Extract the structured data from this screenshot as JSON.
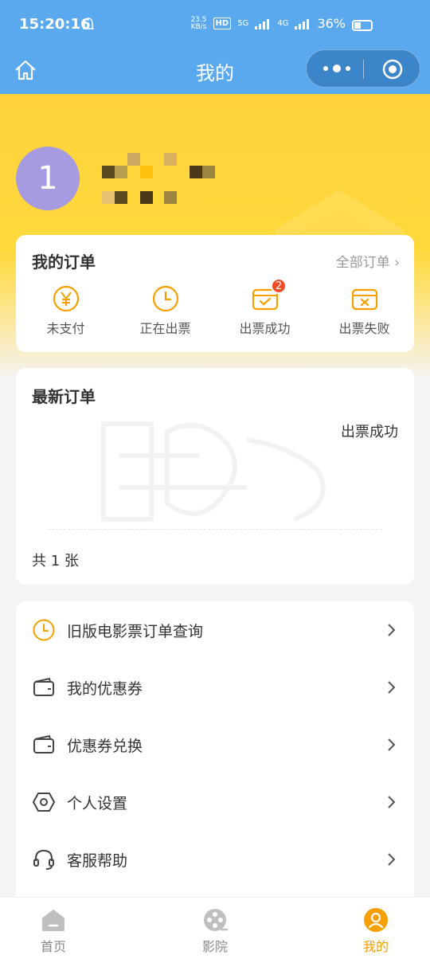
{
  "status_bar": {
    "time": "15:20:16",
    "net_speed_top": "23.5",
    "net_speed_bottom": "KB/s",
    "hd_tag": "HD",
    "sim1": "5G",
    "sim2": "4G",
    "battery": "36%"
  },
  "nav": {
    "title": "我的"
  },
  "profile": {
    "avatar_initial": "1"
  },
  "orders": {
    "title": "我的订单",
    "all_label": "全部订单 ›",
    "items": [
      {
        "label": "未支付",
        "icon": "yen-icon"
      },
      {
        "label": "正在出票",
        "icon": "clock-icon"
      },
      {
        "label": "出票成功",
        "icon": "ticket-check-icon",
        "badge": "2"
      },
      {
        "label": "出票失败",
        "icon": "ticket-cross-icon"
      }
    ]
  },
  "latest": {
    "title": "最新订单",
    "status": "出票成功",
    "count": "共 1 张"
  },
  "menu": {
    "items": [
      {
        "label": "旧版电影票订单查询",
        "icon": "clock-icon"
      },
      {
        "label": "我的优惠券",
        "icon": "wallet-icon"
      },
      {
        "label": "优惠券兑换",
        "icon": "wallet-icon"
      },
      {
        "label": "个人设置",
        "icon": "hexagon-settings-icon"
      },
      {
        "label": "客服帮助",
        "icon": "headset-icon"
      }
    ]
  },
  "tabbar": {
    "items": [
      {
        "label": "首页",
        "icon": "home-icon"
      },
      {
        "label": "影院",
        "icon": "film-reel-icon"
      },
      {
        "label": "我的",
        "icon": "user-icon",
        "active": true
      }
    ]
  },
  "colors": {
    "nav_blue": "#5aa9ee",
    "banner_yellow": "#ffd23a",
    "accent_orange": "#f5a000",
    "badge_red": "#f04a24",
    "avatar_purple": "#a69ae0"
  }
}
